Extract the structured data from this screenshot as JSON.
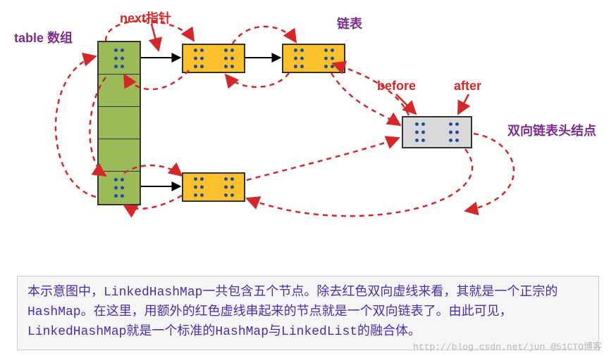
{
  "labels": {
    "table_array": "table 数组",
    "next_ptr": "next指针",
    "linked_list": "链表",
    "before": "before",
    "after": "after",
    "dll_head": "双向链表头结点"
  },
  "description": "本示意图中，LinkedHashMap一共包含五个节点。除去红色双向虚线来看，其就是一个正宗的HashMap。在这里，用额外的红色虚线串起来的节点就是一个双向链表了。由此可见，LinkedHashMap就是一个标准的HashMap与LinkedList的融合体。",
  "watermark": "http://blog.csdn.net/jun  @51CTO博客",
  "colors": {
    "purple": "#7B2D8E",
    "red": "#d62728",
    "orange_node": "#fbc12d",
    "gray_node": "#d9d9d9",
    "green_node": "#9bbb59",
    "dotted_blue": "#1f4e9b",
    "desc_text": "#4b2eab"
  },
  "diagram": {
    "concept": "LinkedHashMap = HashMap + doubly-linked-list ordering",
    "table_slots": 5,
    "occupied_slots": [
      0,
      4
    ],
    "chains": [
      {
        "bucket": 0,
        "length": 3
      },
      {
        "bucket": 4,
        "length": 2
      }
    ],
    "dll_head_node": "gray",
    "dll_pointers": [
      "before",
      "after"
    ],
    "total_nodes": 5
  }
}
